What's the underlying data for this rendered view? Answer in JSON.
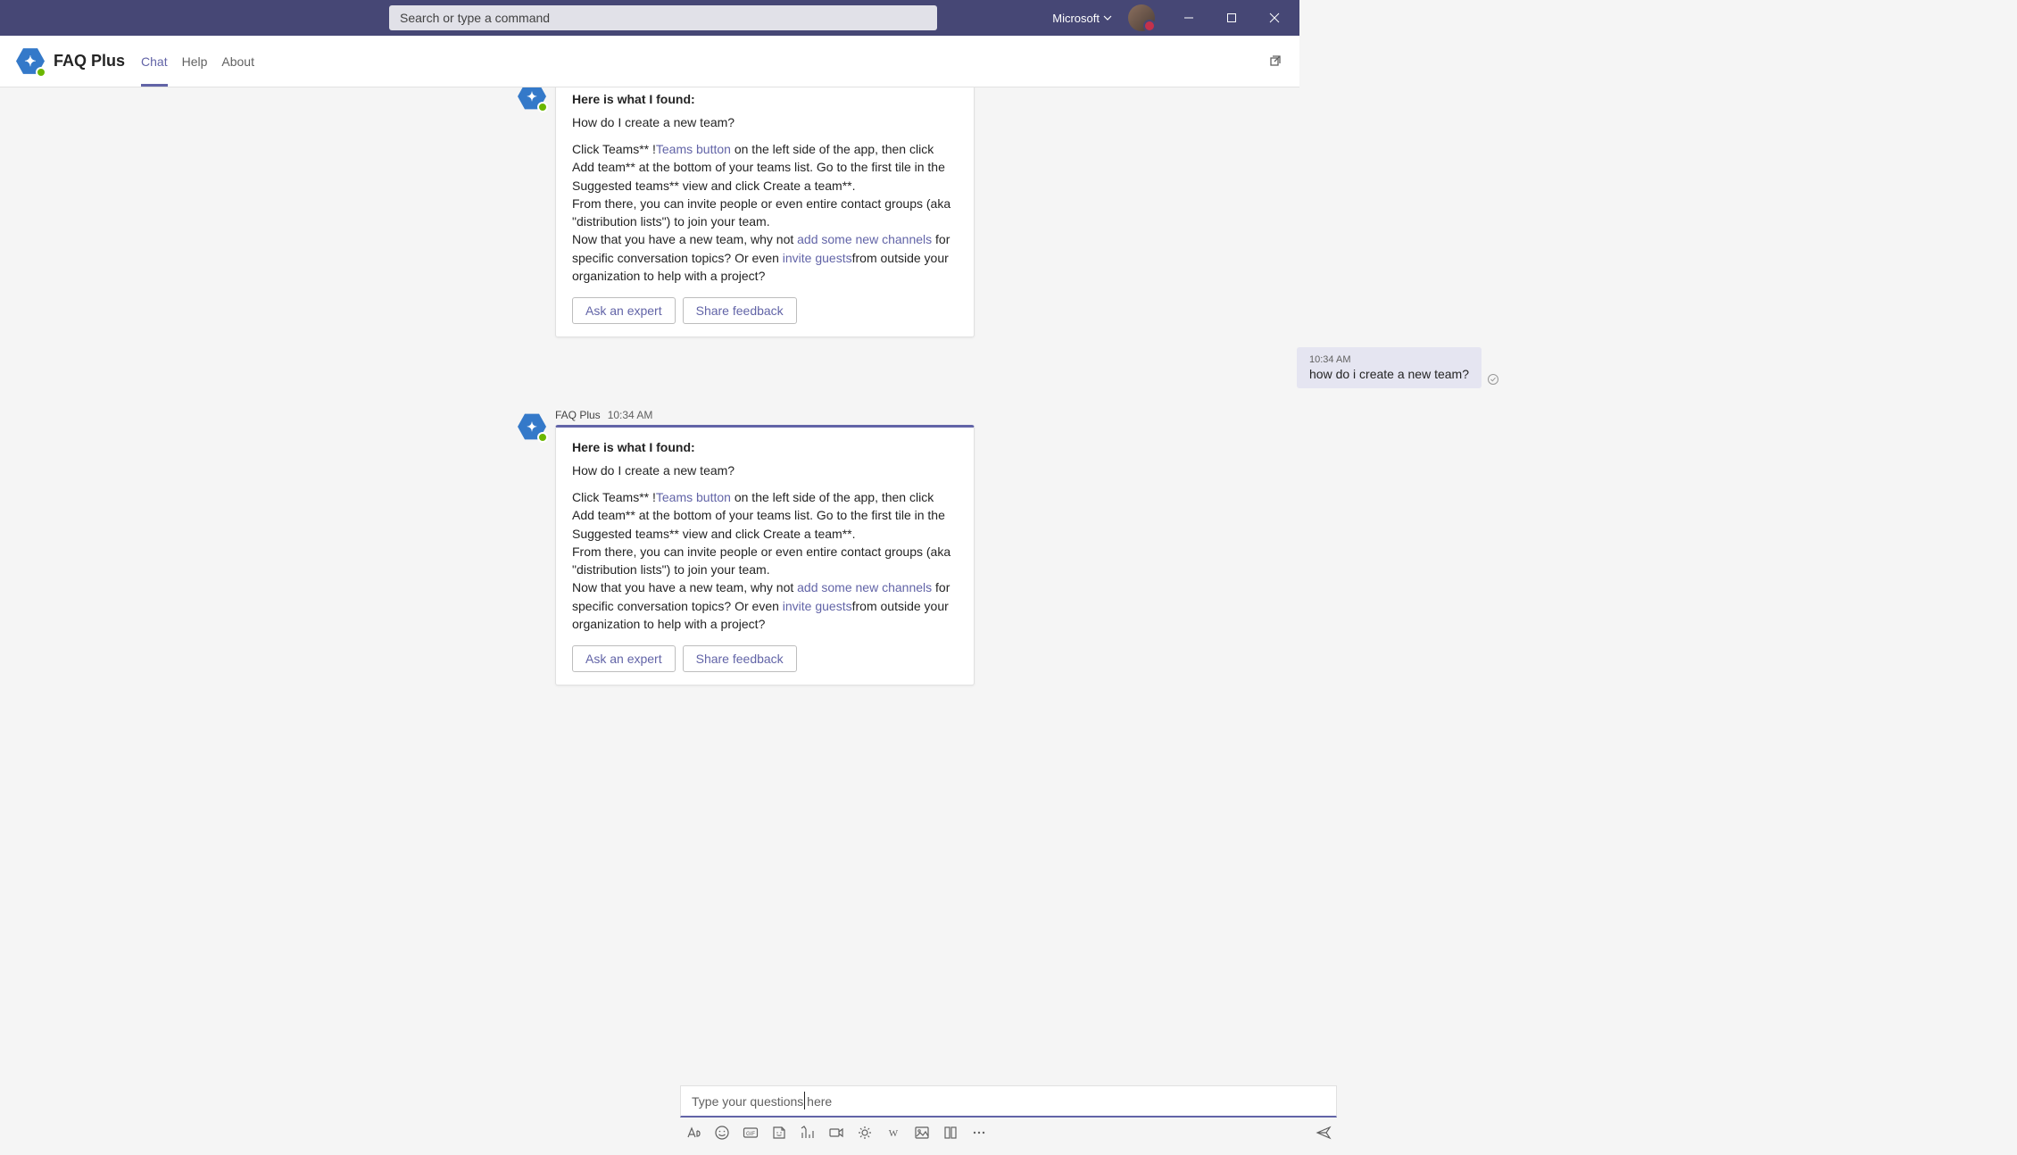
{
  "titlebar": {
    "search_placeholder": "Search or type a command",
    "org": "Microsoft"
  },
  "appbar": {
    "title": "FAQ Plus",
    "tabs": {
      "chat": "Chat",
      "help": "Help",
      "about": "About"
    }
  },
  "bot": {
    "name": "FAQ Plus",
    "time": "10:34 AM"
  },
  "card": {
    "heading": "Here is what I found:",
    "question": "How do I create a new team?",
    "body": {
      "p1a": "Click Teams** !",
      "link1": "Teams button",
      "p1b": " on the left side of the app, then click Add team** at the bottom of your teams list. Go to the first tile in the Suggested teams** view and click Create a team**.",
      "p2": "From there, you can invite people or even entire contact groups (aka \"distribution lists\") to join your team.",
      "p3a": "Now that you have a new team, why not ",
      "link2": "add some new channels",
      "p3b": " for specific conversation topics? Or even ",
      "link3": "invite guests",
      "p3c": "from outside your organization to help with a project?"
    },
    "actions": {
      "ask": "Ask an expert",
      "share": "Share feedback"
    }
  },
  "user_message": {
    "time": "10:34 AM",
    "text": "how do i create a new team?"
  },
  "compose": {
    "placeholder": "Type your questions here"
  }
}
